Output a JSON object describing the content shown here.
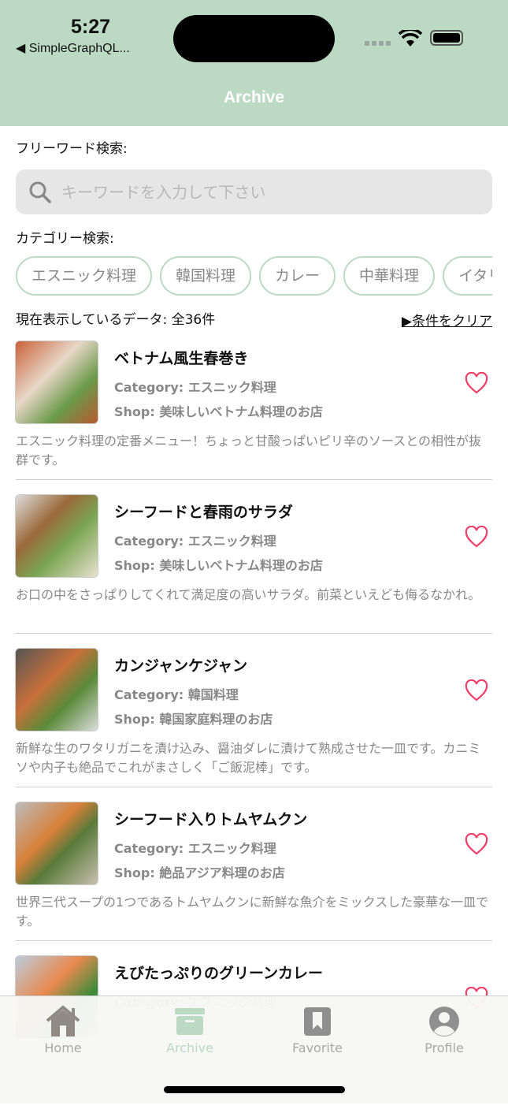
{
  "status": {
    "time": "5:27",
    "back_app": "◀ SimpleGraphQL..."
  },
  "nav": {
    "title": "Archive"
  },
  "search": {
    "label": "フリーワード検索:",
    "placeholder": "キーワードを入力して下さい",
    "value": ""
  },
  "category": {
    "label": "カテゴリー検索:",
    "chips": [
      "エスニック料理",
      "韓国料理",
      "カレー",
      "中華料理",
      "イタリアン"
    ]
  },
  "summary": {
    "count_text": "現在表示しているデータ: 全36件",
    "clear_label": "▶条件をクリア"
  },
  "colors": {
    "accent": "#bcd9c4",
    "heart": "#f0406a"
  },
  "items": [
    {
      "title": "ベトナム風生春巻き",
      "category": "Category: エスニック料理",
      "shop": "Shop: 美味しいベトナム料理のお店",
      "description": "エスニック料理の定番メニュー！ちょっと甘酸っぱいピリ辛のソースとの相性が抜群です。",
      "favorite": false
    },
    {
      "title": "シーフードと春雨のサラダ",
      "category": "Category: エスニック料理",
      "shop": "Shop: 美味しいベトナム料理のお店",
      "description": "お口の中をさっぱりしてくれて満足度の高いサラダ。前菜といえども侮るなかれ。",
      "favorite": false
    },
    {
      "title": "カンジャンケジャン",
      "category": "Category: 韓国料理",
      "shop": "Shop: 韓国家庭料理のお店",
      "description": "新鮮な生のワタリガニを漬け込み、醤油ダレに漬けて熟成させた一皿です。カニミソや内子も絶品でこれがまさしく「ご飯泥棒」です。",
      "favorite": false
    },
    {
      "title": "シーフード入りトムヤムクン",
      "category": "Category: エスニック料理",
      "shop": "Shop: 絶品アジア料理のお店",
      "description": "世界三代スープの1つであるトムヤムクンに新鮮な魚介をミックスした豪華な一皿です。",
      "favorite": false
    },
    {
      "title": "えびたっぷりのグリーンカレー",
      "category": "Category: エスニック料理",
      "favorite": false
    }
  ],
  "tabs": [
    {
      "label": "Home",
      "icon": "house-icon"
    },
    {
      "label": "Archive",
      "icon": "archive-box-icon",
      "active": true
    },
    {
      "label": "Favorite",
      "icon": "bookmark-icon"
    },
    {
      "label": "Profile",
      "icon": "person-circle-icon"
    }
  ]
}
